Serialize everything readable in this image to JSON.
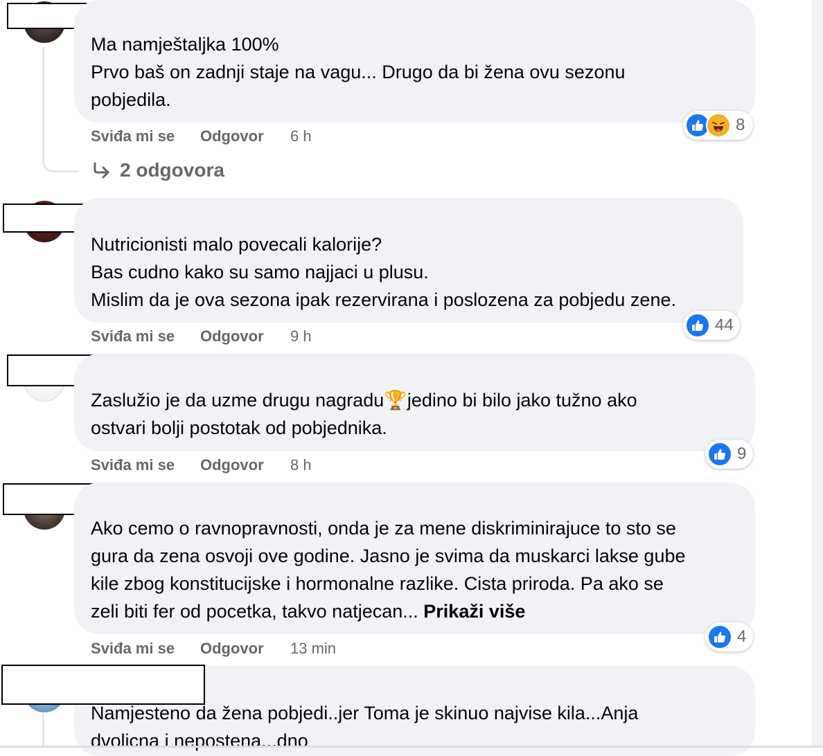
{
  "labels": {
    "like": "Sviđa mi se",
    "reply": "Odgovor",
    "show_more": "Prikaži više"
  },
  "comments": [
    {
      "lines": [
        "Ma namještaljka 100%",
        "Prvo baš on zadnji staje na vagu... Drugo da bi žena ovu sezonu",
        "pobjedila."
      ],
      "time": "6 h",
      "reactions": [
        "like",
        "haha"
      ],
      "reaction_count": "8",
      "replies_label": "2 odgovora"
    },
    {
      "lines": [
        "Nutricionisti malo povecali kalorije?",
        "Bas cudno kako su samo najjaci u plusu.",
        "Mislim da je ova sezona ipak rezervirana i poslozena za pobjedu zene."
      ],
      "time": "9 h",
      "reactions": [
        "like"
      ],
      "reaction_count": "44"
    },
    {
      "lines": [
        "Zaslužio je da uzme drugu nagradu🏆jedino bi bilo jako tužno ako",
        "ostvari bolji postotak od pobjednika."
      ],
      "time": "8 h",
      "reactions": [
        "like"
      ],
      "reaction_count": "9"
    },
    {
      "lines": [
        "Ako cemo o ravnopravnosti, onda je za mene diskriminirajuce to sto se",
        "gura da zena osvoji ove godine. Jasno je svima da muskarci lakse gube",
        "kile zbog konstitucijske i hormonalne razlike. Cista priroda. Pa ako se",
        "zeli biti fer od pocetka, takvo natjecan..."
      ],
      "time": "13 min",
      "reactions": [
        "like"
      ],
      "reaction_count": "4",
      "truncated": true
    },
    {
      "lines": [
        "Namjesteno da žena pobjedi..jer Toma je skinuo najvise kila...Anja",
        "dvolicna i nepostena...dno"
      ]
    }
  ],
  "colors": {
    "bubble": "#f0f2f5",
    "meta": "#65676b",
    "like_blue": "#1877f2",
    "haha_yellow": "#f7b125"
  }
}
